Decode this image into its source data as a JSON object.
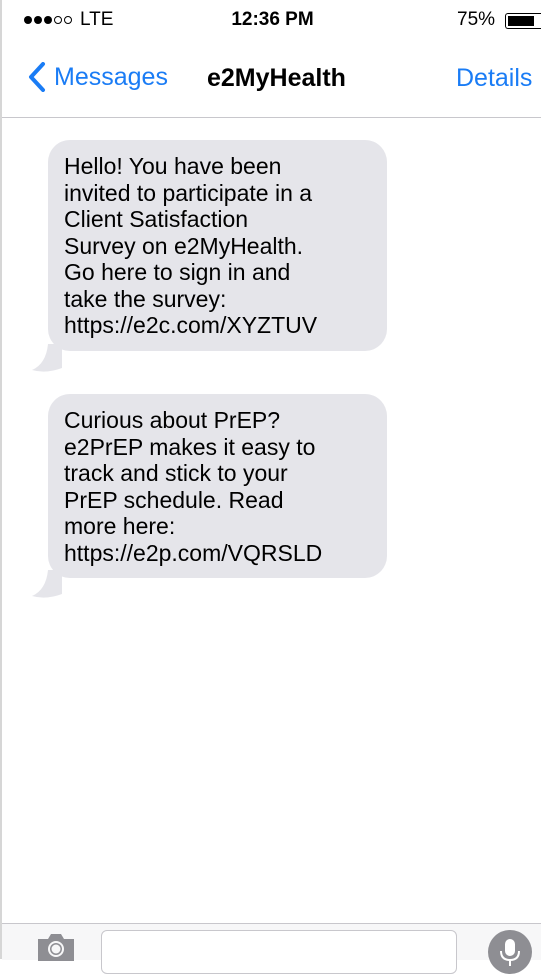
{
  "status_bar": {
    "signal_dots": [
      true,
      true,
      true,
      false,
      false
    ],
    "carrier": "LTE",
    "time": "12:36 PM",
    "battery_percent_label": "75%",
    "battery_level": 0.75
  },
  "nav": {
    "back_label": "Messages",
    "title": "e2MyHealth",
    "details_label": "Details"
  },
  "messages": [
    {
      "lines": [
        "Hello! You have been",
        "invited to participate in a",
        "Client Satisfaction",
        "Survey on e2MyHealth.",
        "Go here to sign in and",
        "take the survey:",
        "https://e2c.com/XYZTUV"
      ]
    },
    {
      "lines": [
        "Curious about PrEP?",
        "e2PrEP makes it easy to",
        "track and stick to your",
        "PrEP schedule. Read",
        "more here:",
        "https://e2p.com/VQRSLD"
      ]
    }
  ],
  "input_bar": {
    "placeholder": ""
  },
  "colors": {
    "accent": "#1a7cf5",
    "bubble": "#e5e5ea",
    "mic": "#8e8e93"
  },
  "icons": {
    "back": "chevron-left-icon",
    "camera": "camera-icon",
    "mic": "microphone-icon"
  }
}
